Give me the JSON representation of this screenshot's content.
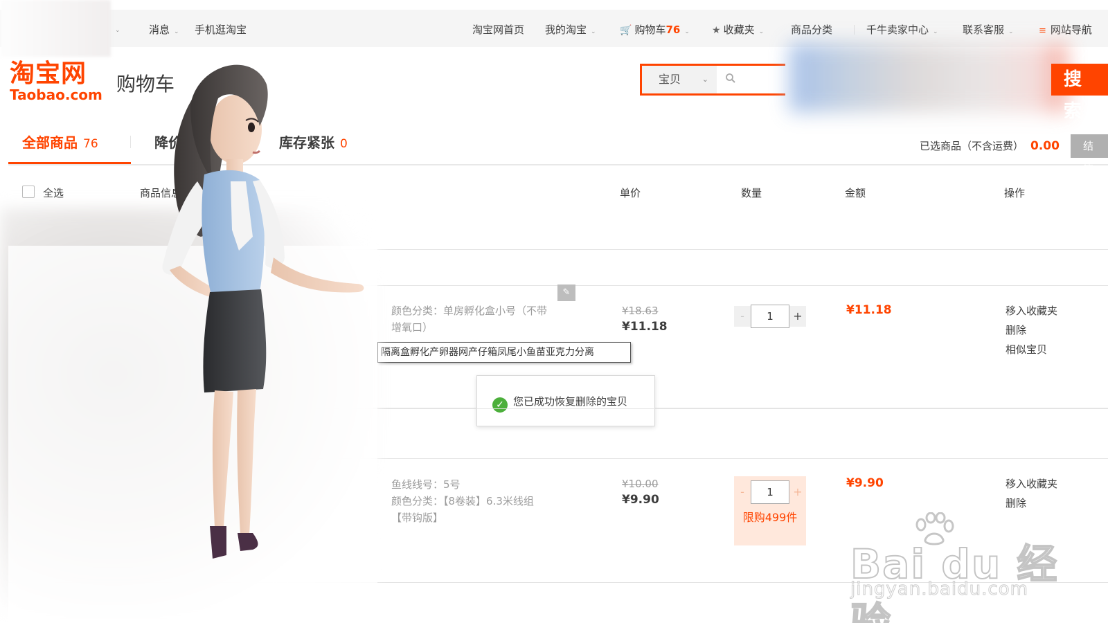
{
  "topbar": {
    "messages": "消息",
    "mobile": "手机逛淘宝",
    "home": "淘宝网首页",
    "my_taobao": "我的淘宝",
    "cart_label": "购物车",
    "cart_count": "76",
    "favorites": "收藏夹",
    "categories": "商品分类",
    "seller_center": "千牛卖家中心",
    "customer_service": "联系客服",
    "site_nav": "网站导航"
  },
  "header": {
    "logo_cn": "淘宝网",
    "logo_en": "Taobao.com",
    "page_title": "购物车"
  },
  "search": {
    "category": "宝贝",
    "button": "搜 索"
  },
  "tabs": [
    {
      "label": "全部商品",
      "count": "76"
    },
    {
      "label": "降价"
    },
    {
      "label": "库存紧张",
      "count": "0"
    }
  ],
  "summary": {
    "selected_label": "已选商品（不含运费）",
    "selected_amount": "0.00",
    "settle": "结 算"
  },
  "columns": {
    "select_all": "全选",
    "info": "商品信息",
    "price": "单价",
    "quantity": "数量",
    "amount": "金额",
    "ops": "操作"
  },
  "items": [
    {
      "sku_1": "颜色分类：单房孵化盒小号（不带",
      "sku_2": "增氧口）",
      "tooltip": "隔离盒孵化产卵器网产仔箱凤尾小鱼苗亚克力分离",
      "old_price": "¥18.63",
      "price": "¥11.18",
      "qty": "1",
      "total": "¥11.18",
      "ops": [
        "移入收藏夹",
        "删除",
        "相似宝贝"
      ]
    },
    {
      "sku_1": "鱼线线号：5号",
      "sku_2": "颜色分类：【8卷装】6.3米线组",
      "sku_3": "【带钩版】",
      "old_price": "¥10.00",
      "price": "¥9.90",
      "qty": "1",
      "limit": "限购499件",
      "total": "¥9.90",
      "ops": [
        "移入收藏夹",
        "删除"
      ]
    }
  ],
  "toast": {
    "message": "您已成功恢复删除的宝贝"
  },
  "watermark": {
    "main": "Bai du 经验",
    "sub": "jingyan.baidu.com"
  },
  "icons": {
    "cart": "cart-icon",
    "star": "star-icon",
    "menu": "menu-icon",
    "search": "search-icon",
    "edit": "pencil-icon",
    "success": "check-circle-icon"
  },
  "colors": {
    "accent": "#ff4400",
    "success": "#4caf3b",
    "limit_bg": "#ffe8dc"
  }
}
